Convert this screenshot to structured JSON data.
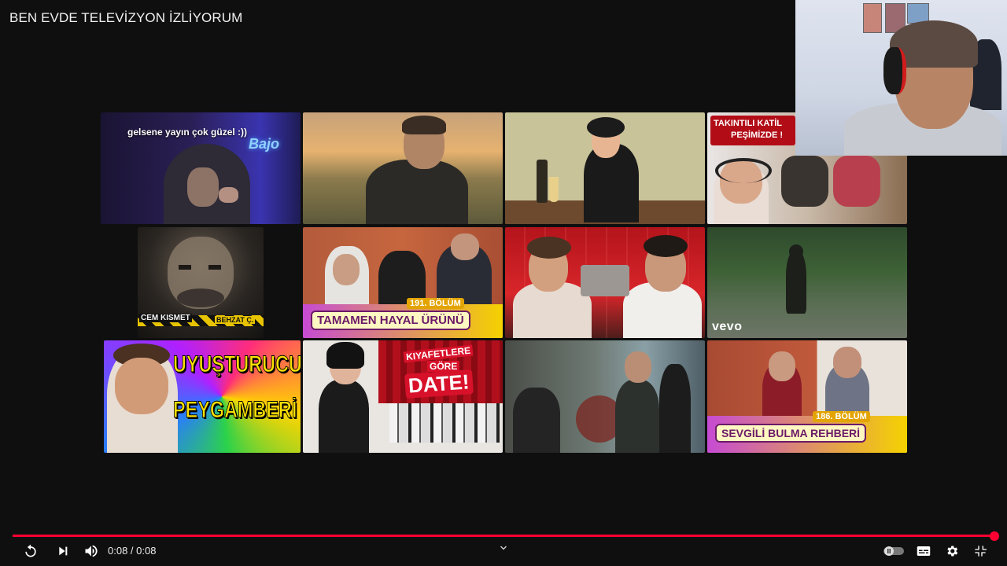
{
  "video": {
    "title": "BEN EVDE TELEVİZYON İZLİYORUM"
  },
  "thumbnails": [
    {
      "caption": "gelsene yayın çok güzel :))",
      "sign": "Bajo"
    },
    {},
    {},
    {
      "caption_line1": "TAKINTILI KATİL",
      "caption_line2": "PEŞİMİZDE !"
    },
    {
      "label_left": "CEM KISMET",
      "label_right": "BEHZAT Ç."
    },
    {
      "episode": "191. BÖLÜM",
      "caption": "TAMAMEN HAYAL ÜRÜNÜ"
    },
    {},
    {
      "logo": "vevo"
    },
    {
      "line1": "UYUŞTURUCU",
      "line2": "PEYGAMBERİ"
    },
    {
      "line1": "KIYAFETLERE",
      "line2": "GÖRE",
      "line3": "DATE!"
    },
    {},
    {
      "episode": "186. BÖLÜM",
      "caption": "SEVGİLİ BULMA REHBERİ"
    }
  ],
  "player": {
    "time_display": "0:08 / 0:08",
    "progress_fraction": 1.0,
    "accent_color": "#ff0033",
    "icons": [
      "replay-icon",
      "next-icon",
      "volume-icon",
      "chevron-down-icon",
      "autoplay-toggle-icon",
      "subtitles-icon",
      "settings-icon",
      "exit-fullscreen-icon"
    ]
  }
}
